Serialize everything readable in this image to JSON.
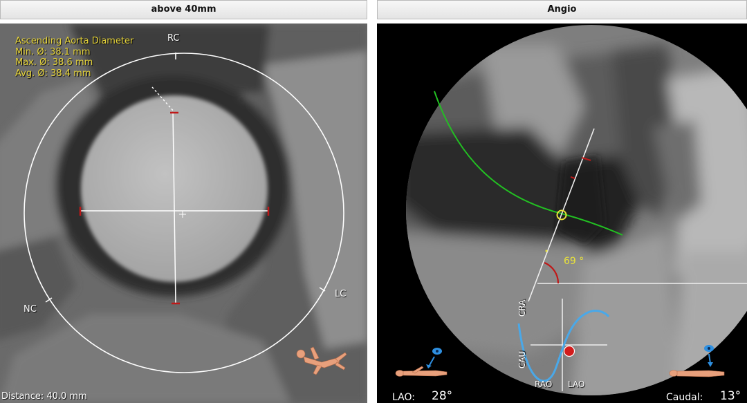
{
  "left_panel": {
    "title": "above 40mm",
    "measurement": {
      "heading": "Ascending Aorta Diameter",
      "min": "Min. Ø: 38.1 mm",
      "max": "Max. Ø: 38.6 mm",
      "avg": "Avg. Ø: 38.4 mm"
    },
    "cusp_labels": {
      "rc": "RC",
      "lc": "LC",
      "nc": "NC"
    },
    "distance": "Distance: 40.0 mm",
    "icons": [
      "patient-orientation-icon"
    ]
  },
  "right_panel": {
    "title": "Angio",
    "angle": "69 °",
    "orientation_labels": {
      "cra": "CRA",
      "cau": "CAU",
      "rao": "RAO",
      "lao": "LAO"
    },
    "lao_label": "LAO:",
    "lao_value": "28°",
    "caudal_label": "Caudal:",
    "caudal_value": "13°",
    "icons": [
      "patient-supine-lao-icon",
      "patient-supine-caudal-icon",
      "eye-icon"
    ],
    "colors": {
      "curve": "#22c022",
      "s_curve": "#4aa8e8",
      "marker": "#d21c1c"
    }
  }
}
